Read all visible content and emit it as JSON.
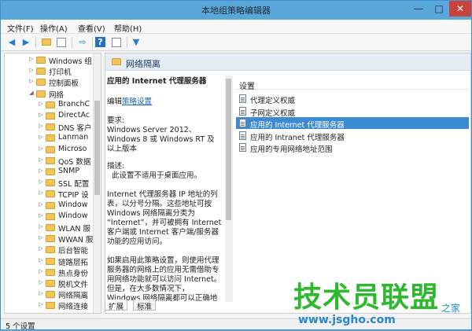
{
  "window": {
    "title": "本地组策略编辑器"
  },
  "window_controls": {
    "minimize": "—",
    "maximize": "□",
    "close": "✕"
  },
  "menu": [
    "文件(F)",
    "操作(A)",
    "查看(V)",
    "帮助(H)"
  ],
  "toolbar": {
    "icons": [
      "back-arrow-icon",
      "forward-arrow-icon",
      "up-folder-icon",
      "show-tree-icon",
      "export-icon",
      "help-icon",
      "properties-icon",
      "filter-icon"
    ]
  },
  "tree": {
    "items": [
      {
        "label": "Windows 组",
        "indent": 1
      },
      {
        "label": "打印机",
        "indent": 1
      },
      {
        "label": "控制面板",
        "indent": 1
      },
      {
        "label": "网络",
        "indent": 1,
        "expanded": true
      },
      {
        "label": "BranchC",
        "indent": 2
      },
      {
        "label": "DirectAc",
        "indent": 2
      },
      {
        "label": "DNS 客户",
        "indent": 2
      },
      {
        "label": "Lanman",
        "indent": 2
      },
      {
        "label": "Microso",
        "indent": 2
      },
      {
        "label": "QoS 数据",
        "indent": 2
      },
      {
        "label": "SNMP",
        "indent": 2
      },
      {
        "label": "SSL 配置",
        "indent": 2
      },
      {
        "label": "TCPIP 设",
        "indent": 2
      },
      {
        "label": "Window",
        "indent": 2
      },
      {
        "label": "Window",
        "indent": 2
      },
      {
        "label": "WLAN 服",
        "indent": 2
      },
      {
        "label": "WWAN 服",
        "indent": 2
      },
      {
        "label": "后台智能",
        "indent": 2
      },
      {
        "label": "链路层拓",
        "indent": 2
      },
      {
        "label": "热点身份",
        "indent": 2
      },
      {
        "label": "脱机文件",
        "indent": 2
      },
      {
        "label": "网络隔离",
        "indent": 2
      },
      {
        "label": "网络连接",
        "indent": 2
      }
    ]
  },
  "pane": {
    "header": "网络隔离",
    "settings_header": "设置"
  },
  "description": {
    "title": "应用的 Internet 代理服务器",
    "edit_prefix": "编辑",
    "edit_link": "策略设置",
    "requirements_label": "要求:",
    "requirements_text": "Windows Server 2012、Windows 8 或 Windows RT 及以上版本",
    "desc_label": "描述:",
    "desc_text": "此设置不适用于桌面应用。",
    "para1": "Internet 代理服务器 IP 地址的列表，以分号分隔。这些地址可按 Windows 网络隔离分类为 “Internet”，并可被拥有 Internet 客户端或 Internet 客户端/服务器功能的应用访问。",
    "para2": "如果启用此策略设置，则使用代理服务器的网络上的应用无需借助专用网络功能就可以访问 Internet。但是，在大多数情况下，Windows 网络隔离都可以正确地"
  },
  "settings": [
    {
      "label": "代理定义权威",
      "selected": false
    },
    {
      "label": "子网定义权威",
      "selected": false
    },
    {
      "label": "应用的 Internet 代理服务器",
      "selected": true
    },
    {
      "label": "应用的 Intranet 代理服务器",
      "selected": false
    },
    {
      "label": "应用的专用网络地址范围",
      "selected": false
    }
  ],
  "tabs": [
    "扩展",
    "标准"
  ],
  "status": {
    "text": "5 个设置"
  },
  "watermark": {
    "main": "技术员联盟",
    "sub": "之家",
    "url": "www.jsgho.com"
  }
}
